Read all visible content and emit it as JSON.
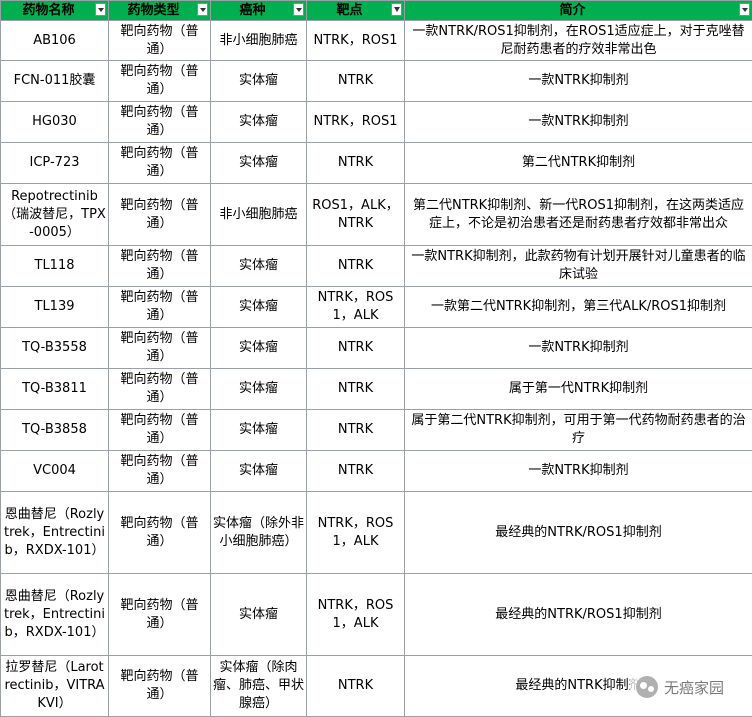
{
  "headers": [
    {
      "label": "药物名称",
      "filter": "dropdown"
    },
    {
      "label": "药物类型",
      "filter": "dropdown"
    },
    {
      "label": "癌种",
      "filter": "dropdown"
    },
    {
      "label": "靶点",
      "filter": "active"
    },
    {
      "label": "简介",
      "filter": "dropdown"
    }
  ],
  "rows": [
    {
      "name": "AB106",
      "type": "靶向药物（普通）",
      "cancer": "非小细胞肺癌",
      "target": "NTRK，ROS1",
      "desc": "一款NTRK/ROS1抑制剂，在ROS1适应症上，对于克唑替尼耐药患者的疗效非常出色"
    },
    {
      "name": "FCN-011胶囊",
      "type": "靶向药物（普通）",
      "cancer": "实体瘤",
      "target": "NTRK",
      "desc": "一款NTRK抑制剂"
    },
    {
      "name": "HG030",
      "type": "靶向药物（普通）",
      "cancer": "实体瘤",
      "target": "NTRK，ROS1",
      "desc": "一款NTRK抑制剂"
    },
    {
      "name": "ICP-723",
      "type": "靶向药物（普通）",
      "cancer": "实体瘤",
      "target": "NTRK",
      "desc": "第二代NTRK抑制剂"
    },
    {
      "name": "Repotrectinib（瑞波替尼，TPX-0005）",
      "type": "靶向药物（普通）",
      "cancer": "非小细胞肺癌",
      "target": "ROS1，ALK，NTRK",
      "desc": "第二代NTRK抑制剂、新一代ROS1抑制剂，在这两类适应症上，不论是初治患者还是耐药患者疗效都非常出众"
    },
    {
      "name": "TL118",
      "type": "靶向药物（普通）",
      "cancer": "实体瘤",
      "target": "NTRK",
      "desc": "一款NTRK抑制剂，此款药物有计划开展针对儿童患者的临床试验"
    },
    {
      "name": "TL139",
      "type": "靶向药物（普通）",
      "cancer": "实体瘤",
      "target": "NTRK，ROS1，ALK",
      "desc": "一款第二代NTRK抑制剂，第三代ALK/ROS1抑制剂"
    },
    {
      "name": "TQ-B3558",
      "type": "靶向药物（普通）",
      "cancer": "实体瘤",
      "target": "NTRK",
      "desc": "一款NTRK抑制剂"
    },
    {
      "name": "TQ-B3811",
      "type": "靶向药物（普通）",
      "cancer": "实体瘤",
      "target": "NTRK",
      "desc": "属于第一代NTRK抑制剂"
    },
    {
      "name": "TQ-B3858",
      "type": "靶向药物（普通）",
      "cancer": "实体瘤",
      "target": "NTRK",
      "desc": "属于第二代NTRK抑制剂，可用于第一代药物耐药患者的治疗"
    },
    {
      "name": "VC004",
      "type": "靶向药物（普通）",
      "cancer": "实体瘤",
      "target": "NTRK",
      "desc": "一款NTRK抑制剂"
    },
    {
      "name": "恩曲替尼（Rozlytrek，Entrectinib，RXDX-101）",
      "type": "靶向药物（普通）",
      "cancer": "实体瘤（除外非小细胞肺癌）",
      "target": "NTRK，ROS1，ALK",
      "desc": "最经典的NTRK/ROS1抑制剂"
    },
    {
      "name": "恩曲替尼（Rozlytrek，Entrectinib，RXDX-101）",
      "type": "靶向药物（普通）",
      "cancer": "实体瘤",
      "target": "NTRK，ROS1，ALK",
      "desc": "最经典的NTRK/ROS1抑制剂"
    },
    {
      "name": "拉罗替尼（Larotrectinib，VITRAKVI）",
      "type": "靶向药物（普通）",
      "cancer": "实体瘤（除肉瘤、肺癌、甲状腺癌）",
      "target": "NTRK",
      "desc": "最经典的NTRK抑制剂"
    }
  ],
  "watermark": {
    "text": "无癌家园",
    "icon": "wechat-icon"
  }
}
